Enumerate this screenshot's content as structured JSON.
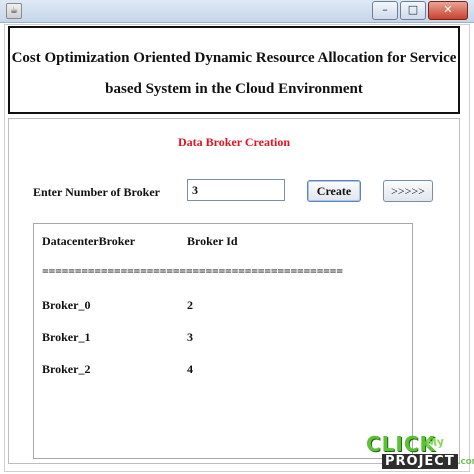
{
  "window": {
    "icon": "java-app-icon",
    "controls": {
      "minimize": "–",
      "maximize": "□",
      "close": "✕"
    }
  },
  "header": {
    "title_line1": "Cost Optimization Oriented Dynamic Resource Allocation for Service",
    "title_line2": "based System in the Cloud Environment"
  },
  "broker_panel": {
    "section_title": "Data Broker Creation",
    "field_label": "Enter Number of Broker",
    "broker_count": "3",
    "create_label": "Create",
    "next_label": ">>>>>"
  },
  "results": {
    "col1_header": "DatacenterBroker",
    "col2_header": "Broker Id",
    "divider": "==============================================",
    "rows": [
      {
        "name": "Broker_0",
        "id": "2"
      },
      {
        "name": "Broker_1",
        "id": "3"
      },
      {
        "name": "Broker_2",
        "id": "4"
      }
    ]
  },
  "watermark": {
    "click": "CLICK",
    "my": "My",
    "project": "PROJECT",
    "com": ".COM"
  },
  "colors": {
    "section_title": "#e0131f",
    "window_close": "#c8412f"
  }
}
